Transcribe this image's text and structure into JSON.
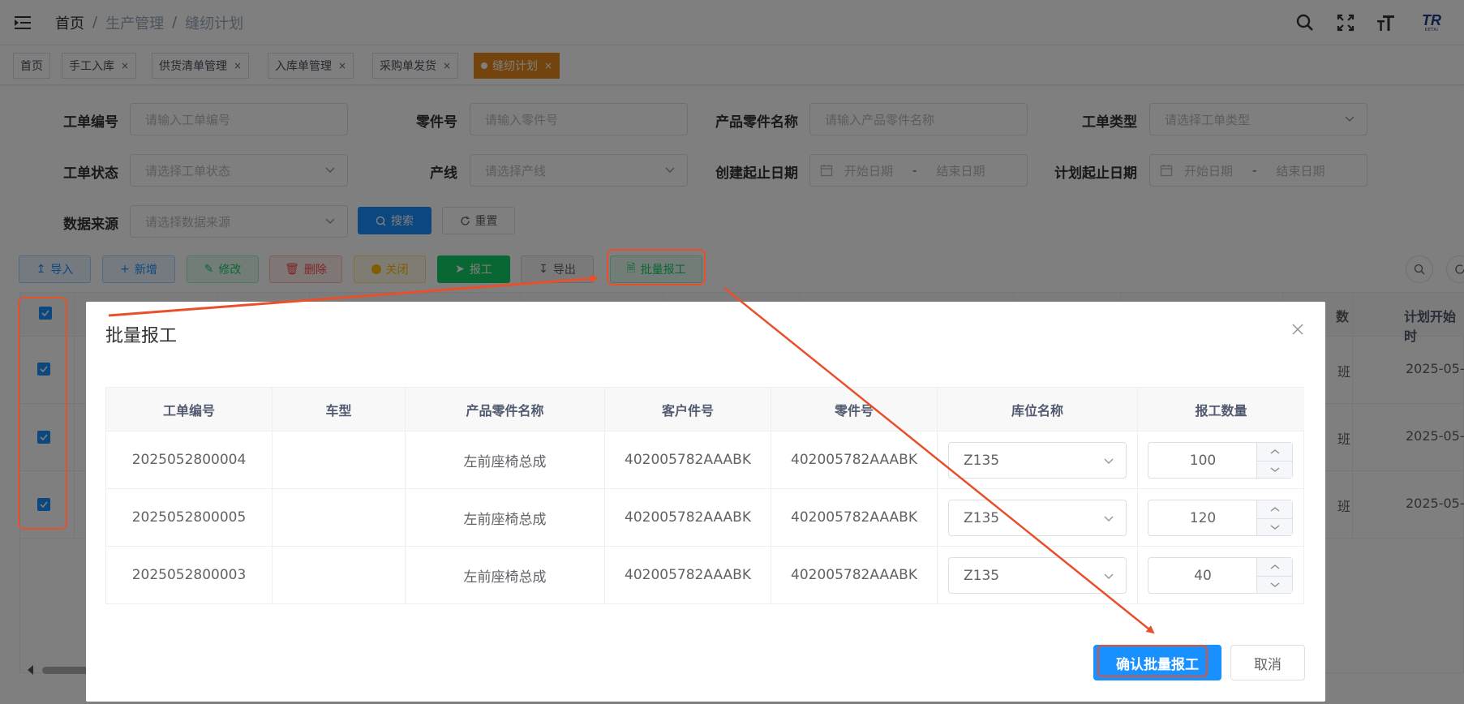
{
  "header": {
    "breadcrumb": [
      "首页",
      "生产管理",
      "缝纫计划"
    ],
    "separator": "/",
    "icons": [
      "search-icon",
      "fullscreen-icon",
      "font-size-icon"
    ],
    "logo_text": "TR",
    "logo_sub": "RETAI"
  },
  "tags": [
    {
      "label": "首页",
      "closable": false
    },
    {
      "label": "手工入库",
      "closable": true
    },
    {
      "label": "供货清单管理",
      "closable": true
    },
    {
      "label": "入库单管理",
      "closable": true
    },
    {
      "label": "采购单发货",
      "closable": true
    },
    {
      "label": "缝纫计划",
      "closable": true,
      "active": true
    }
  ],
  "close_glyph": "×",
  "form": {
    "work_order_no": {
      "label": "工单编号",
      "placeholder": "请输入工单编号"
    },
    "part_no": {
      "label": "零件号",
      "placeholder": "请输入零件号"
    },
    "product_part_name": {
      "label": "产品零件名称",
      "placeholder": "请输入产品零件名称"
    },
    "work_order_type": {
      "label": "工单类型",
      "placeholder": "请选择工单类型"
    },
    "work_order_status": {
      "label": "工单状态",
      "placeholder": "请选择工单状态"
    },
    "production_line": {
      "label": "产线",
      "placeholder": "请选择产线"
    },
    "create_date_range": {
      "label": "创建起止日期",
      "start": "开始日期",
      "end": "结束日期",
      "dash": "-"
    },
    "plan_date_range": {
      "label": "计划起止日期",
      "start": "开始日期",
      "end": "结束日期",
      "dash": "-"
    },
    "data_source": {
      "label": "数据来源",
      "placeholder": "请选择数据来源"
    },
    "search_label": "搜索",
    "reset_label": "重置"
  },
  "toolbar": {
    "import": "导入",
    "add": "新增",
    "edit": "修改",
    "delete": "删除",
    "close": "关闭",
    "report": "报工",
    "export": "导出",
    "batch_report": "批量报工"
  },
  "bg_table": {
    "header_right": "计划开始时",
    "header_partial": "数",
    "rows": [
      {
        "plan_start": "2025-05-",
        "partial": "班"
      },
      {
        "plan_start": "2025-05-",
        "partial": "班"
      },
      {
        "plan_start": "2025-05-",
        "partial": "班"
      }
    ]
  },
  "dialog": {
    "title": "批量报工",
    "columns": [
      "工单编号",
      "车型",
      "产品零件名称",
      "客户件号",
      "零件号",
      "库位名称",
      "报工数量"
    ],
    "rows": [
      {
        "work_order_no": "2025052800004",
        "car_model": "",
        "product_name": "左前座椅总成",
        "customer_part_no": "402005782AAABK",
        "part_no": "402005782AAABK",
        "location": "Z135",
        "quantity": "100"
      },
      {
        "work_order_no": "2025052800005",
        "car_model": "",
        "product_name": "左前座椅总成",
        "customer_part_no": "402005782AAABK",
        "part_no": "402005782AAABK",
        "location": "Z135",
        "quantity": "120"
      },
      {
        "work_order_no": "2025052800003",
        "car_model": "",
        "product_name": "左前座椅总成",
        "customer_part_no": "402005782AAABK",
        "part_no": "402005782AAABK",
        "location": "Z135",
        "quantity": "40"
      }
    ],
    "confirm_label": "确认批量报工",
    "cancel_label": "取消"
  },
  "colors": {
    "primary": "#1890ff",
    "active_tag": "#e6891a",
    "annotation": "#e8502c",
    "success": "#13ce66"
  }
}
